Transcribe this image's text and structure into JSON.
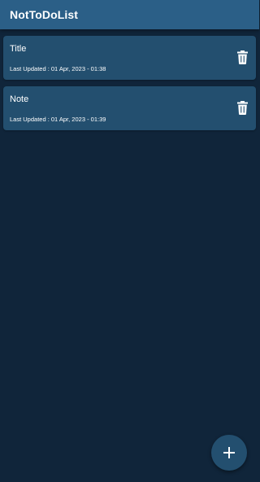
{
  "app_bar": {
    "title": "NotToDoList",
    "color": "#2b5f87"
  },
  "colors": {
    "background": "#10253a",
    "card": "#234f6f",
    "text": "#ffffff"
  },
  "notes": [
    {
      "title": "Title",
      "updated": "Last Updated : 01 Apr, 2023 - 01:38",
      "action_icon": "trash-icon"
    },
    {
      "title": "Note",
      "updated": "Last Updated : 01 Apr, 2023 - 01:39",
      "action_icon": "trash-icon"
    }
  ],
  "fab": {
    "icon": "plus-icon"
  }
}
